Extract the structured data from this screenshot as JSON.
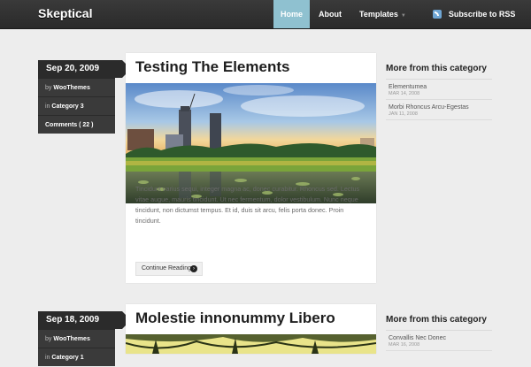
{
  "site": {
    "title": "Skeptical"
  },
  "nav": {
    "home": "Home",
    "about": "About",
    "templates": "Templates",
    "rss": "Subscribe to RSS"
  },
  "posts": [
    {
      "date": "Sep 20, 2009",
      "by_prefix": "by ",
      "author": "WooThemes",
      "in_prefix": "in ",
      "category": "Category 3",
      "comments": "Comments ( 22 )",
      "title": "Testing The Elements",
      "excerpt": "Tincidunt varius sequi, integer magna ac, donec curabitur. Rhoncus sed. Lectus vitae augue, mauris tincidunt. Ut nec fermentum, dolor vestibulum. Nunc neque tincidunt, non dictumst tempus. Et id, duis sit arcu, felis porta donec. Proin tincidunt.",
      "continue": "Continue Reading"
    },
    {
      "date": "Sep 18, 2009",
      "by_prefix": "by ",
      "author": "WooThemes",
      "in_prefix": "in ",
      "category": "Category 1",
      "title": "Molestie innonummy Libero"
    }
  ],
  "sidebars": [
    {
      "title": "More from this category",
      "items": [
        {
          "title": "Elementumea",
          "date": "MAR 14, 2008"
        },
        {
          "title": "Morbi Rhoncus Arcu-Egestas",
          "date": "JAN 11, 2008"
        }
      ]
    },
    {
      "title": "More from this category",
      "items": [
        {
          "title": "Convallis Nec Donec",
          "date": "MAR 16, 2008"
        }
      ]
    }
  ],
  "colors": {
    "header": "#2f2f2f",
    "nav_active": "#8fc1d0",
    "meta_bg": "#2b2b2b",
    "page_bg": "#ededed"
  },
  "icons": [
    "rss-icon",
    "arrow-right-icon",
    "chevron-down-icon"
  ]
}
